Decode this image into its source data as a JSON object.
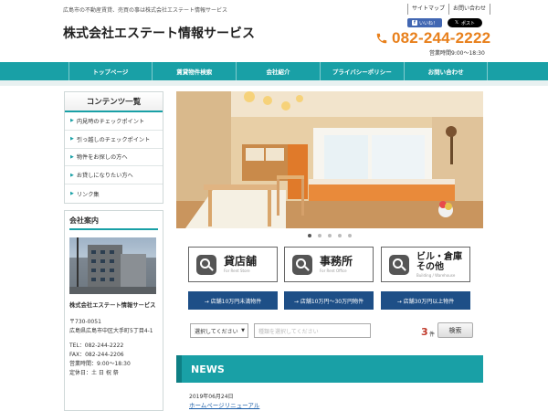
{
  "header": {
    "tagline": "広島市の不動産賃貸、売買の事は株式会社エステート情報サービス",
    "company_name": "株式会社エステート情報サービス",
    "top_links": [
      "サイトマップ",
      "お問い合わせ"
    ],
    "fb_like": "いいね！",
    "x_post": "ポスト",
    "phone": "082-244-2222",
    "hours": "営業時間9:00～18:30",
    "accent_color": "#e8801c"
  },
  "nav": {
    "items": [
      "トップページ",
      "賃貸物件検索",
      "会社紹介",
      "プライバシーポリシー",
      "お問い合わせ"
    ],
    "color": "#19a0a6"
  },
  "sidebar": {
    "contents_title": "コンテンツ一覧",
    "items": [
      "内見時のチェックポイント",
      "引っ越しのチェックポイント",
      "物件をお探しの方へ",
      "お貸しになりたい方へ",
      "リンク集"
    ]
  },
  "about": {
    "title": "会社案内",
    "name": "株式会社エステート情報サービス",
    "postal": "〒730-0051",
    "address": "広島県広島市中区大手町5丁目4-1",
    "tel": "TEL：082-244-2222",
    "fax": "FAX：082-244-2206",
    "hours": "営業時間：9:00～18:30",
    "holiday": "定休日：土 日 祝 祭"
  },
  "slider": {
    "slides": 5,
    "active": 0
  },
  "categories": [
    {
      "label": "貸店舗",
      "sub": "For Rent Store"
    },
    {
      "label": "事務所",
      "sub": "For Rent Office"
    },
    {
      "label": "ビル・倉庫",
      "label2": "その他",
      "sub": "Building / Warehouse"
    }
  ],
  "quick_links": [
    "→ 店舗10万円未満物件",
    "→ 店舗10万円～30万円物件",
    "→ 店舗30万円以上物件"
  ],
  "search": {
    "select_label": "選択してください",
    "type_placeholder": "種類を選択してください",
    "count": "3",
    "count_unit": "件",
    "button": "検索"
  },
  "news": {
    "title": "NEWS",
    "items": [
      {
        "date": "2019年06月24日",
        "title": "ホームページリニューアル"
      }
    ]
  }
}
